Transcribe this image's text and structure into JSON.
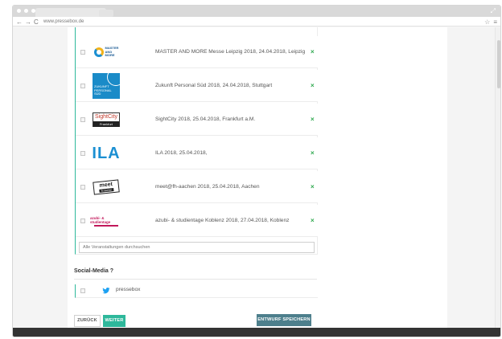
{
  "browser": {
    "url": "www.pressebox.de",
    "nav_back": "←",
    "nav_forward": "→",
    "nav_reload": "C",
    "star": "☆",
    "menu": "≡",
    "resize": "⤢"
  },
  "events": [
    {
      "text": "MASTER AND MORE Messe Leipzig 2018, 24.04.2018, Leipzig",
      "logo": "master-and-more",
      "logo_text": [
        "MASTER",
        "AND",
        "MORE"
      ]
    },
    {
      "text": "Zukunft Personal Süd 2018, 24.04.2018, Stuttgart",
      "logo": "zukunft-personal",
      "logo_text": [
        "ZUKUNFT",
        "PERSONAL",
        "SÜD"
      ]
    },
    {
      "text": "SightCity 2018, 25.04.2018, Frankfurt a.M.",
      "logo": "sightcity",
      "logo_text": [
        "SightCity",
        "Frankfurt"
      ]
    },
    {
      "text": "ILA 2018, 25.04.2018,",
      "logo": "ila",
      "logo_text": [
        "ILA"
      ]
    },
    {
      "text": "meet@fh-aachen 2018, 25.04.2018, Aachen",
      "logo": "meet",
      "logo_text": [
        "meet",
        "fh-aachen"
      ]
    },
    {
      "text": "azubi- & studientage Koblenz 2018, 27.04.2018, Koblenz",
      "logo": "azubi",
      "logo_text": [
        "azubi- & studientage"
      ]
    }
  ],
  "remove_symbol": "×",
  "search": {
    "placeholder": "Alle Veranstaltungen durchsuchen"
  },
  "social": {
    "title": "Social-Media ?",
    "item_label": "pressebox"
  },
  "buttons": {
    "back": "ZURÜCK",
    "next": "WEITER",
    "save": "ENTWURF SPEICHERN"
  },
  "colors": {
    "accent": "#2eb89b",
    "remove": "#2ea84f",
    "save_button": "#4d7f8c",
    "twitter": "#1da1f2"
  }
}
